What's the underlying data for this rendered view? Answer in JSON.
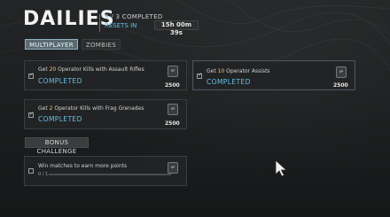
{
  "header": {
    "title": "DAILIES",
    "completed_current": "3",
    "completed_total": "/ 3 COMPLETED",
    "resets_label": "RESETS IN",
    "timer": "15h 00m 39s"
  },
  "tabs": [
    {
      "label": "MULTIPLAYER",
      "active": true
    },
    {
      "label": "ZOMBIES",
      "active": false
    }
  ],
  "challenges": [
    {
      "title_prefix": "Get ",
      "highlight": "20",
      "title_suffix": " Operator Kills with Assault Rifles",
      "status": "COMPLETED",
      "xp": "2500",
      "xp_badge": "XP"
    },
    {
      "title_prefix": "Get ",
      "highlight": "10",
      "title_suffix": " Operator Assists",
      "status": "COMPLETED",
      "xp": "2500",
      "xp_badge": "XP"
    },
    {
      "title_prefix": "Get ",
      "highlight": "2",
      "title_suffix": " Operator Kills with Frag Grenades",
      "status": "COMPLETED",
      "xp": "2500",
      "xp_badge": "XP"
    }
  ],
  "bonus": {
    "label": "BONUS CHALLENGE",
    "title": "Win matches to earn more points",
    "progress_text": "0 / 1",
    "progress_fraction": 0,
    "xp_badge": "XP"
  },
  "colors": {
    "accent": "#63c2e8",
    "highlight": "#f4c56a"
  }
}
